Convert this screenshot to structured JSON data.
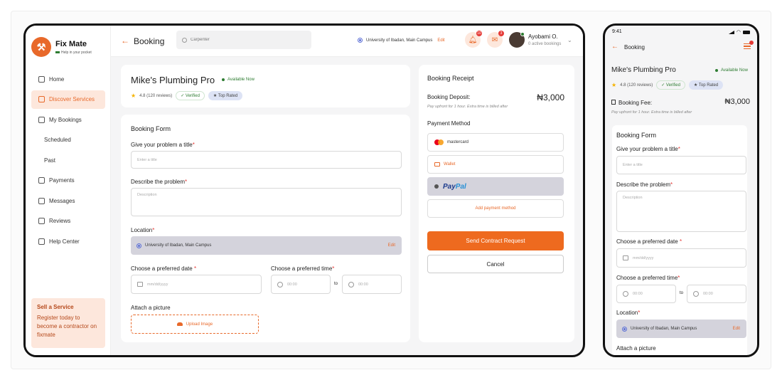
{
  "app": {
    "name": "Fix Mate",
    "tagline": "Help in your pocket"
  },
  "sidebar": {
    "items": [
      {
        "label": "Home"
      },
      {
        "label": "Discover Services"
      },
      {
        "label": "My Bookings"
      },
      {
        "label": "Scheduled"
      },
      {
        "label": "Past"
      },
      {
        "label": "Payments"
      },
      {
        "label": "Messages"
      },
      {
        "label": "Reviews"
      },
      {
        "label": "Help Center"
      }
    ],
    "sell": {
      "title": "Sell a Service",
      "body": "Register today to become a contractor on fixmate"
    }
  },
  "header": {
    "title": "Booking",
    "search_placeholder": "Carpenter",
    "location": "University of Ibadan, Main Campus",
    "edit": "Edit",
    "notif_count": "10",
    "msg_count": "3",
    "user_name": "Ayobami O.",
    "user_sub": "0 active bookings"
  },
  "provider": {
    "name": "Mike's Plumbing Pro",
    "status": "Available Now",
    "rating": "4.8 (120 reviews)",
    "verified": "Verified",
    "top_rated": "Top Rated"
  },
  "form": {
    "title": "Booking Form",
    "title_label": "Give your problem a title",
    "title_placeholder": "Enter a title",
    "desc_label": "Describe the problem",
    "desc_placeholder": "Description",
    "location_label": "Location",
    "location_value": "University of Ibadan, Main Campus",
    "location_edit": "Edit",
    "date_label": "Choose a preferred date",
    "date_placeholder": "mm/dd/yyyy",
    "time_label": "Choose a preferred time",
    "time_from": "00:00",
    "time_to": "00:00",
    "to": "to",
    "picture_label": "Attach a picture",
    "upload": "Upload Image",
    "required_mark": "*"
  },
  "receipt": {
    "title": "Booking Receipt",
    "deposit_label": "Booking Deposit:",
    "deposit_amount": "₦3,000",
    "note": "Pay upfront for 1 hour. Extra time is billed after",
    "method_title": "Payment Method",
    "mastercard": "mastercard",
    "wallet": "Wallet",
    "paypal_a": "Pay",
    "paypal_b": "Pal",
    "add_method": "Add payment method",
    "send": "Send Contract Request",
    "cancel": "Cancel"
  },
  "mobile": {
    "time": "9:41",
    "title": "Booking",
    "fee_label": "Booking Fee:",
    "fee_amount": "₦3,000",
    "fee_note": "Pay upfront for 1 hour. Extra time is billed after"
  }
}
